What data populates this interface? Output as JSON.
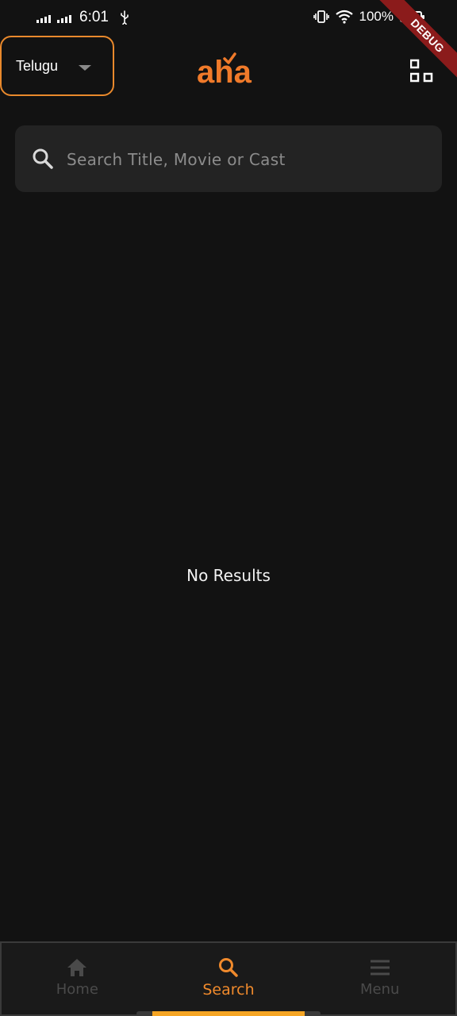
{
  "status_bar": {
    "time": "6:01",
    "battery_text": "100%"
  },
  "header": {
    "language": "Telugu",
    "logo_text": "aha",
    "debug_label": "DEBUG"
  },
  "search": {
    "placeholder": "Search Title, Movie or Cast",
    "value": ""
  },
  "main": {
    "empty_message": "No Results"
  },
  "bottom_nav": {
    "items": [
      {
        "label": "Home",
        "icon": "home-icon"
      },
      {
        "label": "Search",
        "icon": "search-icon",
        "active": true
      },
      {
        "label": "Menu",
        "icon": "menu-icon"
      }
    ]
  },
  "colors": {
    "accent": "#f08a2c",
    "background": "#121212",
    "surface": "#232323",
    "inactive": "#4a4a4a"
  }
}
